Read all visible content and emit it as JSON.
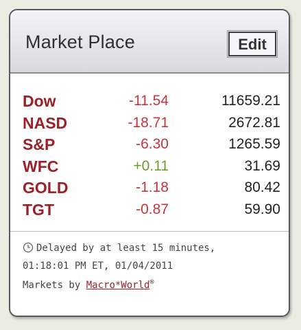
{
  "widget": {
    "title": "Market Place",
    "edit_label": "Edit"
  },
  "quotes": [
    {
      "symbol": "Dow",
      "change": "-11.54",
      "price": "11659.21"
    },
    {
      "symbol": "NASD",
      "change": "-18.71",
      "price": "2672.81"
    },
    {
      "symbol": "S&P",
      "change": "-6.30",
      "price": "1265.59"
    },
    {
      "symbol": "WFC",
      "change": "+0.11",
      "price": "31.69"
    },
    {
      "symbol": "GOLD",
      "change": "-1.18",
      "price": "80.42"
    },
    {
      "symbol": "TGT",
      "change": "-0.87",
      "price": "59.90"
    }
  ],
  "footer": {
    "delay_text": "Delayed by at least 15 minutes,",
    "timestamp": "01:18:01 PM ET, 01/04/2011",
    "markets_by": "Markets by",
    "provider": "Macro*World",
    "reg_mark": "®"
  },
  "colors": {
    "symbol": "#9c2027",
    "negative": "#c7353a",
    "positive": "#6a9c2c"
  },
  "icons": {
    "clock": "clock-icon"
  }
}
